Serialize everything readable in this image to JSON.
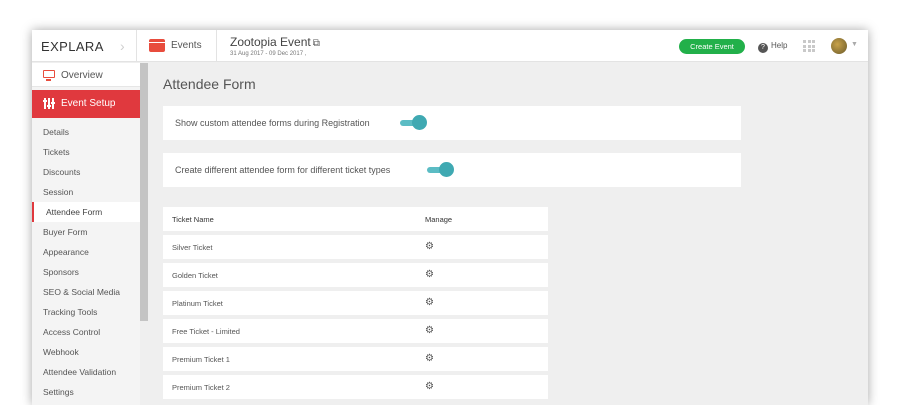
{
  "header": {
    "logo_text": "EXPLARA",
    "section_label": "Events",
    "event_title": "Zootopia Event",
    "event_dates": "31 Aug 2017 - 09 Dec 2017 ,",
    "create_button": "Create Event",
    "help_label": "Help",
    "icons": [
      "calendar-icon",
      "external-link-icon",
      "help-icon",
      "apps-grid-icon",
      "avatar",
      "chevron-down-icon"
    ],
    "accent_color": "#e0393e",
    "create_button_color": "#22b04a"
  },
  "sidebar": {
    "overview_label": "Overview",
    "event_setup_label": "Event Setup",
    "items": [
      {
        "label": "Details"
      },
      {
        "label": "Tickets"
      },
      {
        "label": "Discounts"
      },
      {
        "label": "Session"
      },
      {
        "label": "Attendee Form",
        "active": true
      },
      {
        "label": "Buyer Form"
      },
      {
        "label": "Appearance"
      },
      {
        "label": "Sponsors"
      },
      {
        "label": "SEO & Social Media"
      },
      {
        "label": "Tracking Tools"
      },
      {
        "label": "Access Control"
      },
      {
        "label": "Webhook"
      },
      {
        "label": "Attendee Validation"
      },
      {
        "label": "Settings"
      }
    ]
  },
  "main": {
    "title": "Attendee Form",
    "options": [
      {
        "label": "Show custom attendee forms during Registration",
        "enabled": true
      },
      {
        "label": "Create different attendee form for different ticket types",
        "enabled": true
      }
    ],
    "toggle_color": "#3fa9b2",
    "table": {
      "headers": [
        "Ticket Name",
        "Manage"
      ],
      "rows": [
        {
          "name": "Silver Ticket",
          "manage_icon": "gear-icon"
        },
        {
          "name": "Golden Ticket",
          "manage_icon": "gear-icon"
        },
        {
          "name": "Platinum Ticket",
          "manage_icon": "gear-icon"
        },
        {
          "name": "Free Ticket - Limited",
          "manage_icon": "gear-icon"
        },
        {
          "name": "Premium Ticket 1",
          "manage_icon": "gear-icon"
        },
        {
          "name": "Premium Ticket 2",
          "manage_icon": "gear-icon"
        }
      ]
    }
  }
}
